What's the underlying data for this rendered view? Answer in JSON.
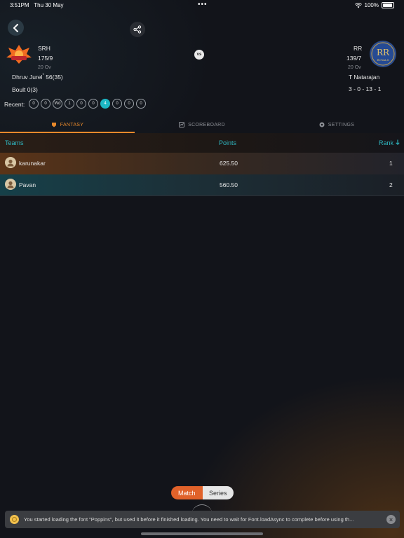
{
  "status_bar": {
    "time": "3:51PM",
    "date": "Thu 30 May",
    "dots": "•••",
    "battery": "100%"
  },
  "match": {
    "team1": {
      "code": "SRH",
      "score": "175/9",
      "overs": "20 Ov"
    },
    "team2": {
      "code": "RR",
      "score": "139/7",
      "overs": "20 Ov",
      "logo_text": "ROYALS"
    },
    "vs": "vs",
    "batsman1": "Dhruv Jurel",
    "batsman1_mark": "*",
    "batsman1_score": "56(35)",
    "batsman2": "Boult 0(3)",
    "bowler": "T Natarajan",
    "bowler_figures": "3 - 0 - 13 - 1"
  },
  "recent": {
    "label": "Recent:",
    "balls": [
      "0",
      "0",
      "Wd",
      "1",
      "0",
      "0",
      "4",
      "0",
      "0",
      "0"
    ],
    "highlight_index": 6
  },
  "tabs": [
    {
      "label": "FANTASY"
    },
    {
      "label": "SCOREBOARD"
    },
    {
      "label": "SETTINGS"
    }
  ],
  "table": {
    "headers": {
      "teams": "Teams",
      "points": "Points",
      "rank": "Rank"
    },
    "rows": [
      {
        "name": "karunakar",
        "points": "625.50",
        "rank": "1"
      },
      {
        "name": "Pavan",
        "points": "560.50",
        "rank": "2"
      }
    ]
  },
  "toggle": {
    "match": "Match",
    "series": "Series"
  },
  "toast": {
    "message": "You started loading the font \"Poppins\", but used it before it finished loading. You need to wait for Font.loadAsync to complete before using th..."
  },
  "colors": {
    "accent_orange": "#e8892b",
    "accent_teal": "#2fb6c0",
    "active_ball": "#1db7c4",
    "background": "#12141a"
  }
}
